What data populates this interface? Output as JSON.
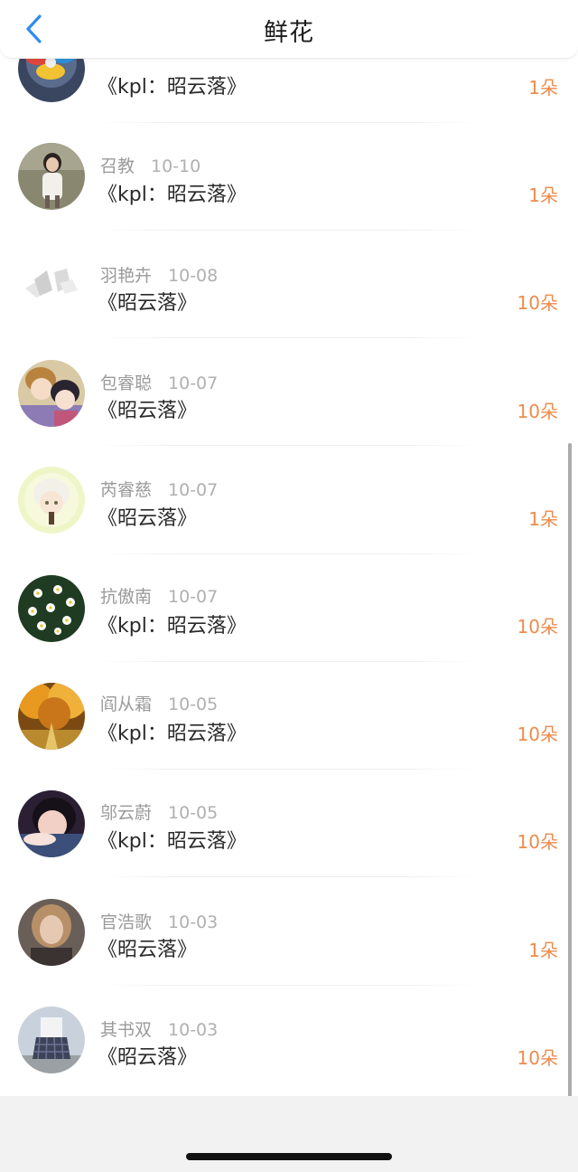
{
  "header": {
    "title": "鲜花",
    "accent_color": "#2d8cf0",
    "back_icon": "chevron-left-icon"
  },
  "items": [
    {
      "user": "",
      "date": "",
      "work": "《kpl：昭云落》",
      "count": "1朵",
      "avatar": "fidget-spinner"
    },
    {
      "user": "召教",
      "date": "10-10",
      "work": "《kpl：昭云落》",
      "count": "1朵",
      "avatar": "child-photo"
    },
    {
      "user": "羽艳卉",
      "date": "10-08",
      "work": "《昭云落》",
      "count": "10朵",
      "avatar": "light-sketch"
    },
    {
      "user": "包睿聪",
      "date": "10-07",
      "work": "《昭云落》",
      "count": "10朵",
      "avatar": "anime-couple"
    },
    {
      "user": "芮睿慈",
      "date": "10-07",
      "work": "《昭云落》",
      "count": "1朵",
      "avatar": "anime-white-hair"
    },
    {
      "user": "抗傲南",
      "date": "10-07",
      "work": "《kpl：昭云落》",
      "count": "10朵",
      "avatar": "daisies"
    },
    {
      "user": "阎从霜",
      "date": "10-05",
      "work": "《kpl：昭云落》",
      "count": "10朵",
      "avatar": "autumn-trees"
    },
    {
      "user": "邬云蔚",
      "date": "10-05",
      "work": "《kpl：昭云落》",
      "count": "10朵",
      "avatar": "girl-selfie"
    },
    {
      "user": "官浩歌",
      "date": "10-03",
      "work": "《昭云落》",
      "count": "1朵",
      "avatar": "woman-portrait"
    },
    {
      "user": "其书双",
      "date": "10-03",
      "work": "《昭云落》",
      "count": "10朵",
      "avatar": "plaid-skirt-photo"
    }
  ],
  "colors": {
    "count": "#ee8b4c",
    "meta": "#9a9a9a"
  }
}
